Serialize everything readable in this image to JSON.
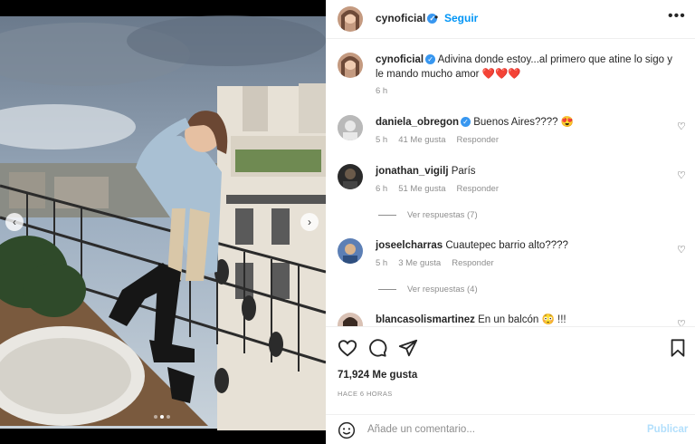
{
  "post": {
    "author": "cynoficial",
    "follow_label": "Seguir",
    "separator": "•",
    "more_label": "•••",
    "caption_text": "Adivina donde estoy...al primero que atine lo sigo y le mando mucho amor",
    "caption_hearts": "❤️❤️❤️",
    "caption_time": "6 h"
  },
  "comments": [
    {
      "user": "daniela_obregon",
      "verified": true,
      "text": "Buenos Aires????",
      "emoji": "😍",
      "time": "5 h",
      "likes": "41 Me gusta",
      "reply": "Responder",
      "replies": null
    },
    {
      "user": "jonathan_vigilj",
      "verified": false,
      "text": "París",
      "emoji": "",
      "time": "6 h",
      "likes": "51 Me gusta",
      "reply": "Responder",
      "replies": "Ver respuestas (7)"
    },
    {
      "user": "joseelcharras",
      "verified": false,
      "text": "Cuautepec barrio alto????",
      "emoji": "",
      "time": "5 h",
      "likes": "3 Me gusta",
      "reply": "Responder",
      "replies": "Ver respuestas (4)"
    },
    {
      "user": "blancasolismartinez",
      "verified": false,
      "text": "En un balcón",
      "emoji": "😳 !!!",
      "time": "",
      "likes": "",
      "reply": "",
      "replies": null
    }
  ],
  "stats": {
    "likes": "71,924 Me gusta",
    "time_ago": "HACE 6 HORAS"
  },
  "composer": {
    "placeholder": "Añade un comentario...",
    "publish_label": "Publicar"
  },
  "carousel": {
    "total": 3,
    "active": 1
  },
  "icons": {
    "like": "heart-icon",
    "comment": "comment-icon",
    "share": "share-icon",
    "save": "bookmark-icon",
    "emoji": "emoji-icon",
    "verified": "verified-badge-icon"
  },
  "colors": {
    "link_blue": "#0095f6",
    "verified_blue": "#3897f0",
    "muted": "#8e8e8e",
    "publish_disabled": "#b2dffc"
  }
}
